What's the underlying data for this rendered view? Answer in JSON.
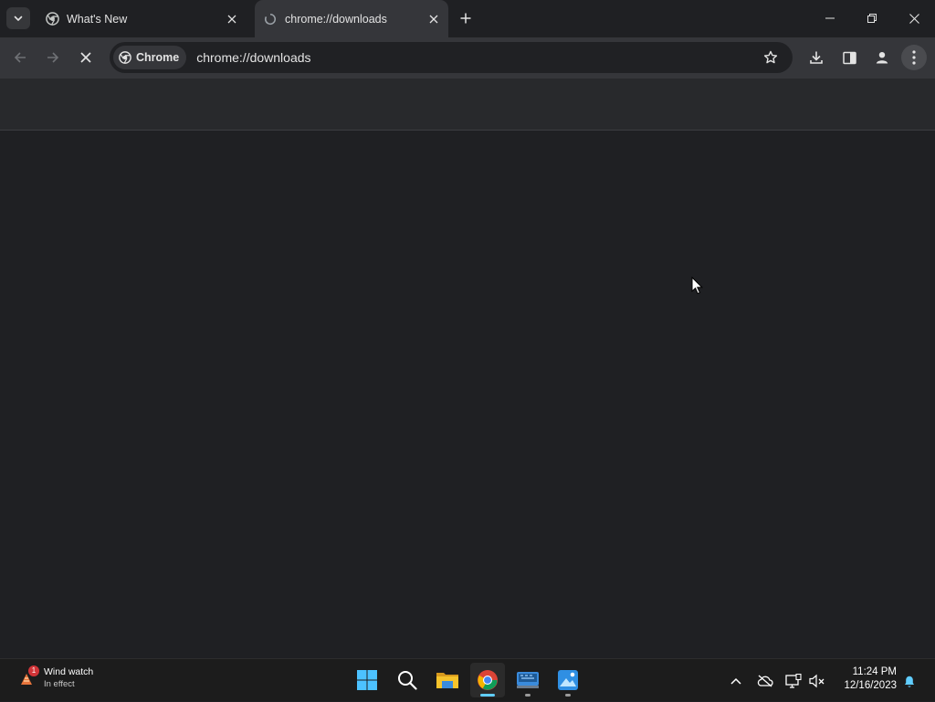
{
  "tabs": [
    {
      "title": "What's New",
      "favicon": "chrome-icon"
    },
    {
      "title": "chrome://downloads",
      "favicon": "loading-icon",
      "active": true
    }
  ],
  "omnibox": {
    "chip_label": "Chrome",
    "url": "chrome://downloads"
  },
  "taskbar": {
    "weather_title": "Wind watch",
    "weather_subtitle": "In effect",
    "weather_badge": "1",
    "clock_time": "11:24 PM",
    "clock_date": "12/16/2023",
    "apps": [
      "start-icon",
      "search-icon",
      "file-explorer-icon",
      "chrome-icon",
      "keyboard-app-icon",
      "photos-app-icon"
    ]
  },
  "colors": {
    "tab_bar": "#1f2023",
    "toolbar": "#35363a",
    "omnibox": "#202124",
    "content": "#1f2023",
    "taskbar": "#1c1c1c",
    "accent": "#60cdff"
  }
}
